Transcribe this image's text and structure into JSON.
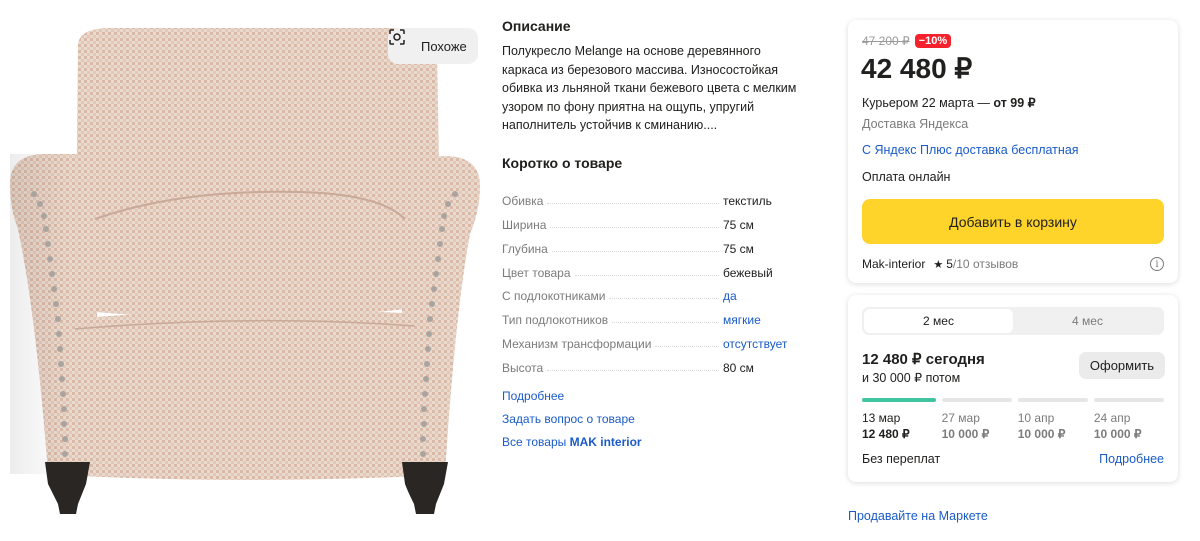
{
  "gallery": {
    "similar_label": "Похоже"
  },
  "description": {
    "title": "Описание",
    "text": "Полукресло Melange на основе деревянного каркаса из березового массива. Износостойкая обивка из льняной ткани бежевого цвета с мелким узором по фону приятна на ощупь, упругий наполнитель устойчив к сминанию...."
  },
  "specs": {
    "title": "Коротко о товаре",
    "rows": [
      {
        "name": "Обивка",
        "value": "текстиль",
        "link": false
      },
      {
        "name": "Ширина",
        "value": "75 см",
        "link": false
      },
      {
        "name": "Глубина",
        "value": "75 см",
        "link": false
      },
      {
        "name": "Цвет товара",
        "value": "бежевый",
        "link": false
      },
      {
        "name": "С подлокотниками",
        "value": "да",
        "link": true
      },
      {
        "name": "Тип подлокотников",
        "value": "мягкие",
        "link": true
      },
      {
        "name": "Механизм трансформации",
        "value": "отсутствует",
        "link": true
      },
      {
        "name": "Высота",
        "value": "80 см",
        "link": false
      }
    ]
  },
  "links": {
    "more": "Подробнее",
    "ask": "Задать вопрос о товаре",
    "all_prefix": "Все товары ",
    "all_brand": "MAK interior"
  },
  "offer": {
    "old_price": "47 200 ₽",
    "discount": "−10%",
    "price": "42 480 ₽",
    "delivery_prefix": "Курьером 22 марта — ",
    "delivery_price": "от 99 ₽",
    "delivery_by": "Доставка Яндекса",
    "plus_free": "С Яндекс Плюс доставка бесплатная",
    "payment": "Оплата онлайн",
    "add_to_cart": "Добавить в корзину",
    "seller": "Mak-interior",
    "star": "★",
    "rating": "5",
    "reviews": "/10 отзывов",
    "info": "i"
  },
  "installment": {
    "tabs": [
      {
        "label": "2 мес",
        "active": true
      },
      {
        "label": "4 мес",
        "active": false
      }
    ],
    "today": "12 480 ₽ сегодня",
    "later": "и 30 000 ₽ потом",
    "apply_label": "Оформить",
    "schedule": [
      {
        "date": "13 мар",
        "amount": "12 480 ₽",
        "paid": true
      },
      {
        "date": "27 мар",
        "amount": "10 000 ₽",
        "paid": false
      },
      {
        "date": "10 апр",
        "amount": "10 000 ₽",
        "paid": false
      },
      {
        "date": "24 апр",
        "amount": "10 000 ₽",
        "paid": false
      }
    ],
    "no_overpay": "Без переплат",
    "more": "Подробнее"
  },
  "sell_on_market": "Продавайте на Маркете",
  "colors": {
    "accent_yellow": "#fed42b",
    "link_blue": "#1a5bc7",
    "discount_red": "#f5222d",
    "installment_green": "#41c4a0"
  }
}
